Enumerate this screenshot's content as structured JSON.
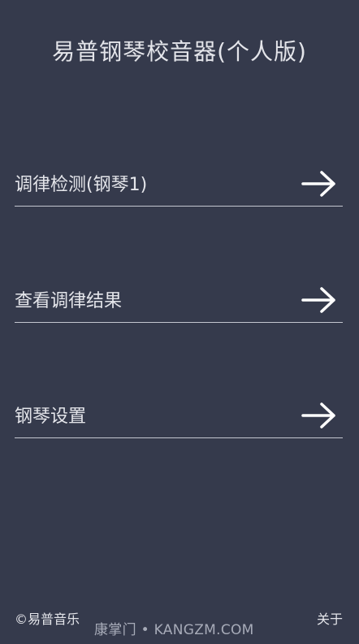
{
  "header": {
    "title": "易普钢琴校音器(个人版)"
  },
  "menu": {
    "items": [
      {
        "label": "调律检测(钢琴1)",
        "icon": "arrow-right-icon"
      },
      {
        "label": "查看调律结果",
        "icon": "arrow-right-icon"
      },
      {
        "label": "钢琴设置",
        "icon": "arrow-right-icon"
      }
    ]
  },
  "footer": {
    "copyright": "©易普音乐",
    "about": "关于",
    "watermark": "康掌门 • KANGZM.COM"
  },
  "colors": {
    "background": "#353a4c",
    "text": "#e4e5ea",
    "divider": "#c4c7d0"
  }
}
